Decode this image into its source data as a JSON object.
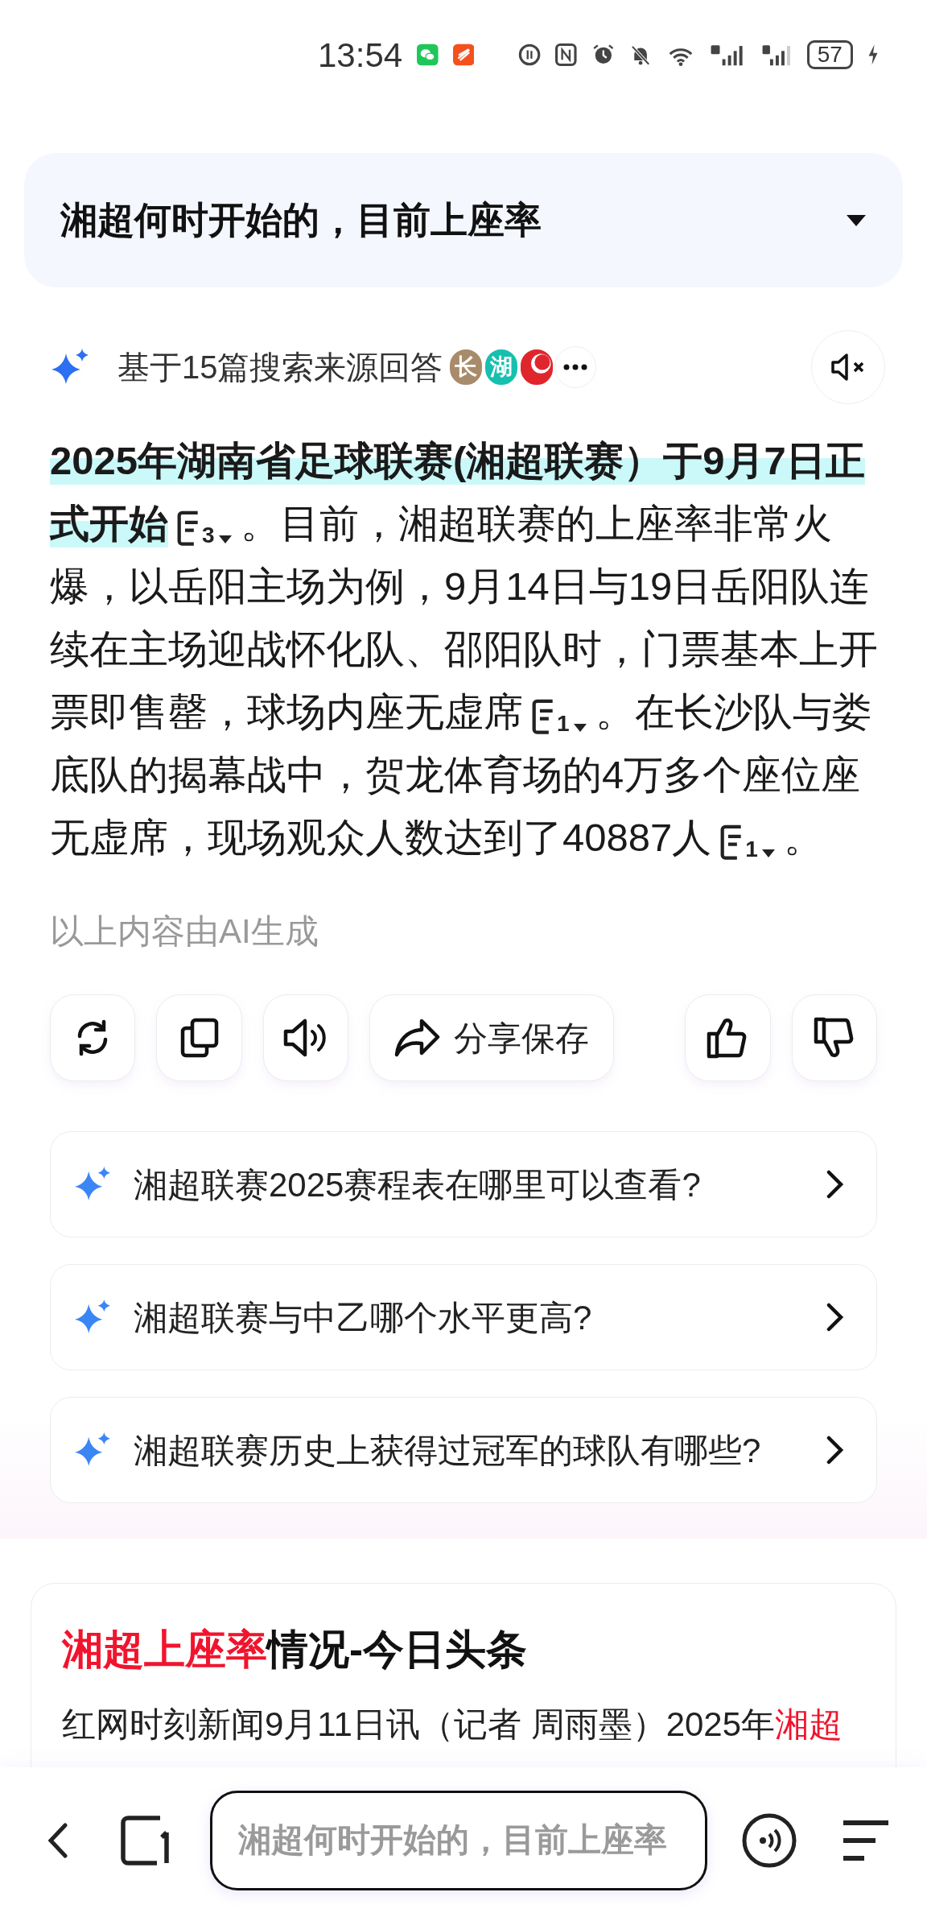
{
  "status_bar": {
    "time": "13:54",
    "battery": "57"
  },
  "query": {
    "text": "湘超何时开始的，目前上座率",
    "expanded": false
  },
  "sources": {
    "label": "基于15篇搜索来源回答",
    "avatars": [
      {
        "kind": "letter",
        "label": "长",
        "color": "#a88b6b"
      },
      {
        "kind": "letter",
        "label": "湖",
        "color": "#17bfae"
      },
      {
        "kind": "logo",
        "color": "#e0262d"
      }
    ]
  },
  "answer_lines": [
    {
      "segments": [
        {
          "kind": "text",
          "text": "2025年湖南省足球联赛(湘超联赛）于9月7日正",
          "bold": true,
          "highlighted": true
        }
      ]
    },
    {
      "segments": [
        {
          "kind": "text",
          "text": "式开始",
          "bold": true,
          "highlighted": true
        },
        {
          "kind": "citation",
          "count": "3"
        },
        {
          "kind": "text",
          "text": "。目前，湘超联赛的上座率非常火",
          "bold": false,
          "highlighted": false
        }
      ]
    },
    {
      "segments": [
        {
          "kind": "text",
          "text": "爆，以岳阳主场为例，9月14日与19日岳阳队连",
          "bold": false,
          "highlighted": false
        }
      ]
    },
    {
      "segments": [
        {
          "kind": "text",
          "text": "续在主场迎战怀化队、邵阳队时，门票基本上开",
          "bold": false,
          "highlighted": false
        }
      ]
    },
    {
      "segments": [
        {
          "kind": "text",
          "text": "票即售罄，球场内座无虚席",
          "bold": false,
          "highlighted": false
        },
        {
          "kind": "citation",
          "count": "1"
        },
        {
          "kind": "text",
          "text": "。在长沙队与娄",
          "bold": false,
          "highlighted": false
        }
      ]
    },
    {
      "segments": [
        {
          "kind": "text",
          "text": "底队的揭幕战中，贺龙体育场的4万多个座位座",
          "bold": false,
          "highlighted": false
        }
      ]
    },
    {
      "segments": [
        {
          "kind": "text",
          "text": "无虚席，现场观众人数达到了40887人",
          "bold": false,
          "highlighted": false
        },
        {
          "kind": "citation",
          "count": "1"
        },
        {
          "kind": "text",
          "text": "。",
          "bold": false,
          "highlighted": false
        }
      ]
    }
  ],
  "ai_note": "以上内容由AI生成",
  "actions": [
    {
      "kind": "refresh"
    },
    {
      "kind": "copy"
    },
    {
      "kind": "speaker"
    },
    {
      "kind": "share",
      "label": "分享保存"
    },
    {
      "kind": "like"
    },
    {
      "kind": "dislike"
    }
  ],
  "suggestions": [
    "湘超联赛2025赛程表在哪里可以查看?",
    "湘超联赛与中乙哪个水平更高?",
    "湘超联赛历史上获得过冠军的球队有哪些?"
  ],
  "news_card": {
    "title": [
      {
        "text": "湘超上座率",
        "highlighted": true
      },
      {
        "text": "情况-今日头条",
        "highlighted": false
      }
    ],
    "body": [
      {
        "text": "红网时刻新闻9月11日讯（记者 周雨墨）2025年",
        "highlighted": false
      },
      {
        "text": "湘超",
        "highlighted": true
      }
    ]
  },
  "bottom_bar": {
    "placeholder": "湘超何时开始的，目前上座率"
  }
}
